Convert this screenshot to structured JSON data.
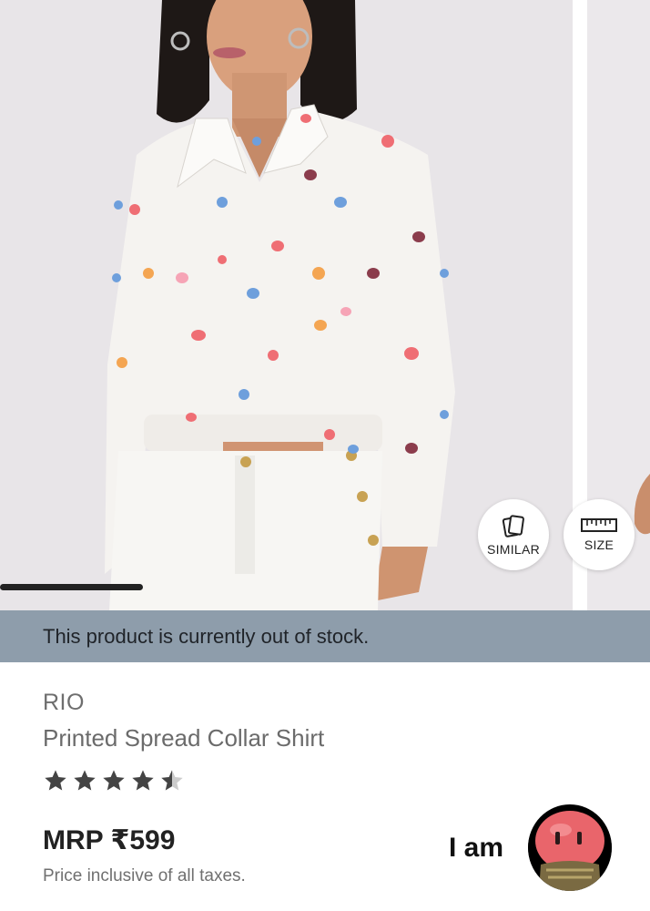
{
  "gallery": {
    "similar_label": "SIMILAR",
    "size_label": "SIZE",
    "slide_index": 1
  },
  "stock": {
    "message": "This product is currently out of stock."
  },
  "product": {
    "brand": "RIO",
    "title": "Printed Spread Collar Shirt",
    "rating": 4.5,
    "rating_max": 5,
    "price": "MRP ₹599",
    "tax_note": "Price inclusive of all taxes."
  },
  "chat": {
    "label": "I am"
  },
  "colors": {
    "out_of_stock_bar": "#8e9dab",
    "star": "#444444",
    "star_empty": "#cccccc",
    "indicator": "#222222"
  }
}
